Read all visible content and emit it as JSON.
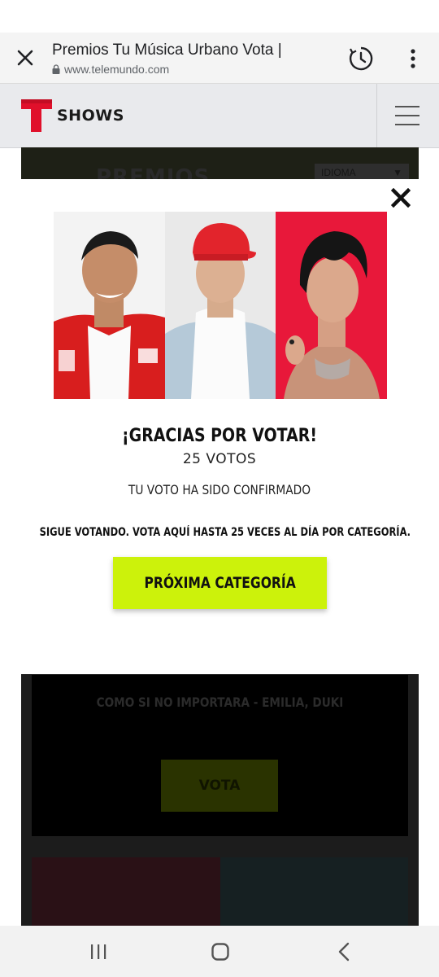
{
  "browser": {
    "page_title": "Premios Tu Música Urbano Vota |",
    "url": "www.telemundo.com",
    "icons": {
      "close": "close-icon",
      "lock": "lock-icon",
      "history": "history-icon",
      "menu": "more-vert-icon"
    }
  },
  "site": {
    "brand_label": "SHOWS",
    "brand_color": "#e0102b",
    "menu_icon": "hamburger-icon"
  },
  "background_page": {
    "banner_text": "PREMIOS",
    "language_select": "IDIOMA",
    "song": "COMO SI NO IMPORTARA - EMILIA, DUKI",
    "vote_label": "VOTA"
  },
  "modal": {
    "close_icon": "close-x-icon",
    "title": "¡GRACIAS POR VOTAR!",
    "votes": "25 VOTOS",
    "confirmation": "TU VOTO HA SIDO CONFIRMADO",
    "info": "SIGUE VOTANDO. VOTA AQUÍ HASTA 25 VECES AL DÍA POR CATEGORÍA.",
    "next_button": "PRÓXIMA CATEGORÍA",
    "accent_color": "#ccf20b"
  },
  "system_nav": {
    "recents": "recents-icon",
    "home": "home-icon",
    "back": "back-icon"
  }
}
